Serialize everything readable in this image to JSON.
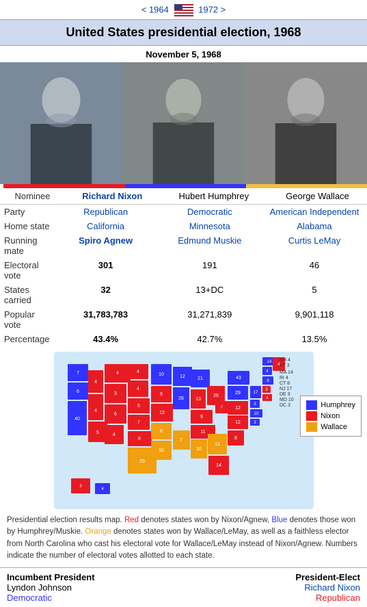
{
  "nav": {
    "prev_year": "1964",
    "next_year": "1972",
    "prev_label": "< 1964",
    "next_label": "1972 >"
  },
  "header": {
    "title": "United States presidential election, 1968",
    "date": "November 5, 1968"
  },
  "candidates": [
    {
      "name": "Richard Nixon",
      "party": "Republican",
      "home_state": "California",
      "running_mate": "Spiro Agnew",
      "electoral_vote": "301",
      "states_carried": "32",
      "popular_vote": "31,783,783",
      "percentage": "43.4%",
      "photo_label": "Nixon",
      "column": "nixon"
    },
    {
      "name": "Hubert Humphrey",
      "party": "Democratic",
      "home_state": "Minnesota",
      "running_mate": "Edmund Muskie",
      "electoral_vote": "191",
      "states_carried": "13+DC",
      "popular_vote": "31,271,839",
      "percentage": "42.7%",
      "photo_label": "Humphrey",
      "column": "humphrey"
    },
    {
      "name": "George Wallace",
      "party": "American Independent",
      "home_state": "Alabama",
      "running_mate": "Curtis LeMay",
      "electoral_vote": "46",
      "states_carried": "5",
      "popular_vote": "9,901,118",
      "percentage": "13.5%",
      "photo_label": "Wallace",
      "column": "wallace"
    }
  ],
  "info_rows": {
    "nominee_label": "Nominee",
    "party_label": "Party",
    "home_state_label": "Home state",
    "running_mate_label": "Running mate",
    "electoral_vote_label": "Electoral vote",
    "states_carried_label": "States carried",
    "popular_vote_label": "Popular vote",
    "percentage_label": "Percentage"
  },
  "map": {
    "legend": [
      {
        "label": "Humphrey",
        "color": "#3333FF"
      },
      {
        "label": "Nixon",
        "color": "#E81B23"
      },
      {
        "label": "Wallace",
        "color": "#F0A010"
      }
    ],
    "caption": "Presidential election results map. Red denotes states won by Nixon/Agnew, Blue denotes those won by Humphrey/Muskie. Orange denotes states won by Wallace/LeMay, as well as a faithless elector from North Carolina who cast his electoral vote for Wallace/LeMay instead of Nixon/Agnew. Numbers indicate the number of electoral votes allotted to each state."
  },
  "bottom": {
    "incumbent_label": "Incumbent President",
    "incumbent_name": "Lyndon Johnson",
    "incumbent_party": "Democratic",
    "elect_label": "President-Elect",
    "elect_name": "Richard Nixon",
    "elect_party": "Republican"
  }
}
